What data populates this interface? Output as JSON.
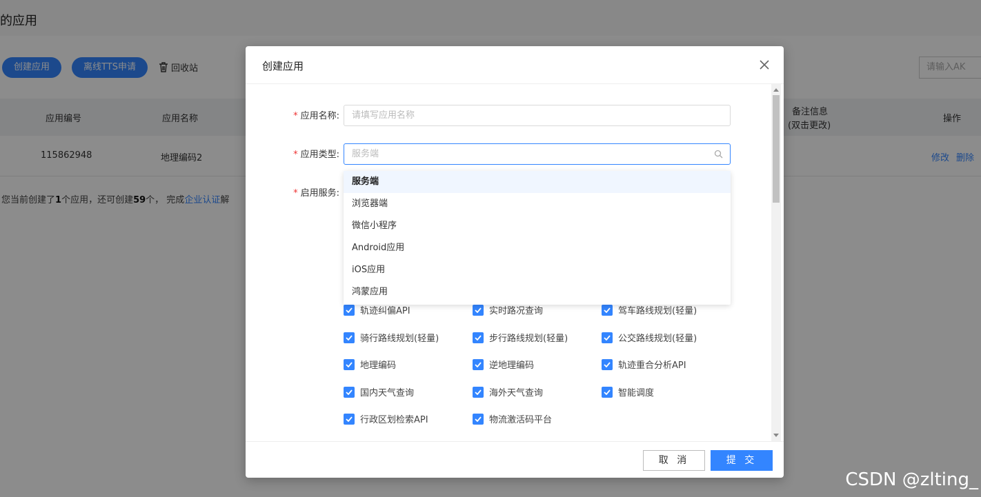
{
  "page": {
    "title": "的应用",
    "create_button": "创建应用",
    "tts_button": "离线TTS申请",
    "recycle_label": "回收站",
    "ak_placeholder": "请输入AK",
    "table": {
      "headers": [
        "应用编号",
        "应用名称",
        "备注信息",
        "(双击更改)",
        "操作"
      ],
      "row": {
        "id": "115862948",
        "name": "地理编码2",
        "edit": "修改",
        "delete": "删除"
      }
    },
    "note": {
      "p1": "您当前创建了",
      "n1": "1",
      "p2": "个应用，还可创建",
      "n2": "59",
      "p3": "个， 完成",
      "link": "企业认证",
      "p4": "解"
    }
  },
  "modal": {
    "title": "创建应用",
    "fields": {
      "name_label": "应用名称:",
      "name_placeholder": "请填写应用名称",
      "type_label": "应用类型:",
      "type_placeholder": "服务端",
      "service_label": "启用服务:",
      "required_mark": "*"
    },
    "dropdown_options": [
      "服务端",
      "浏览器端",
      "微信小程序",
      "Android应用",
      "iOS应用",
      "鸿蒙应用"
    ],
    "services": [
      "轨迹纠偏API",
      "实时路况查询",
      "驾车路线规划(轻量)",
      "骑行路线规划(轻量)",
      "步行路线规划(轻量)",
      "公交路线规划(轻量)",
      "地理编码",
      "逆地理编码",
      "轨迹重合分析API",
      "国内天气查询",
      "海外天气查询",
      "智能调度",
      "行政区划检索API",
      "物流激活码平台"
    ],
    "cancel": "取 消",
    "submit": "提 交"
  },
  "watermark": "CSDN @zlting_",
  "colors": {
    "primary": "#3385ff",
    "required": "#ee3333"
  }
}
